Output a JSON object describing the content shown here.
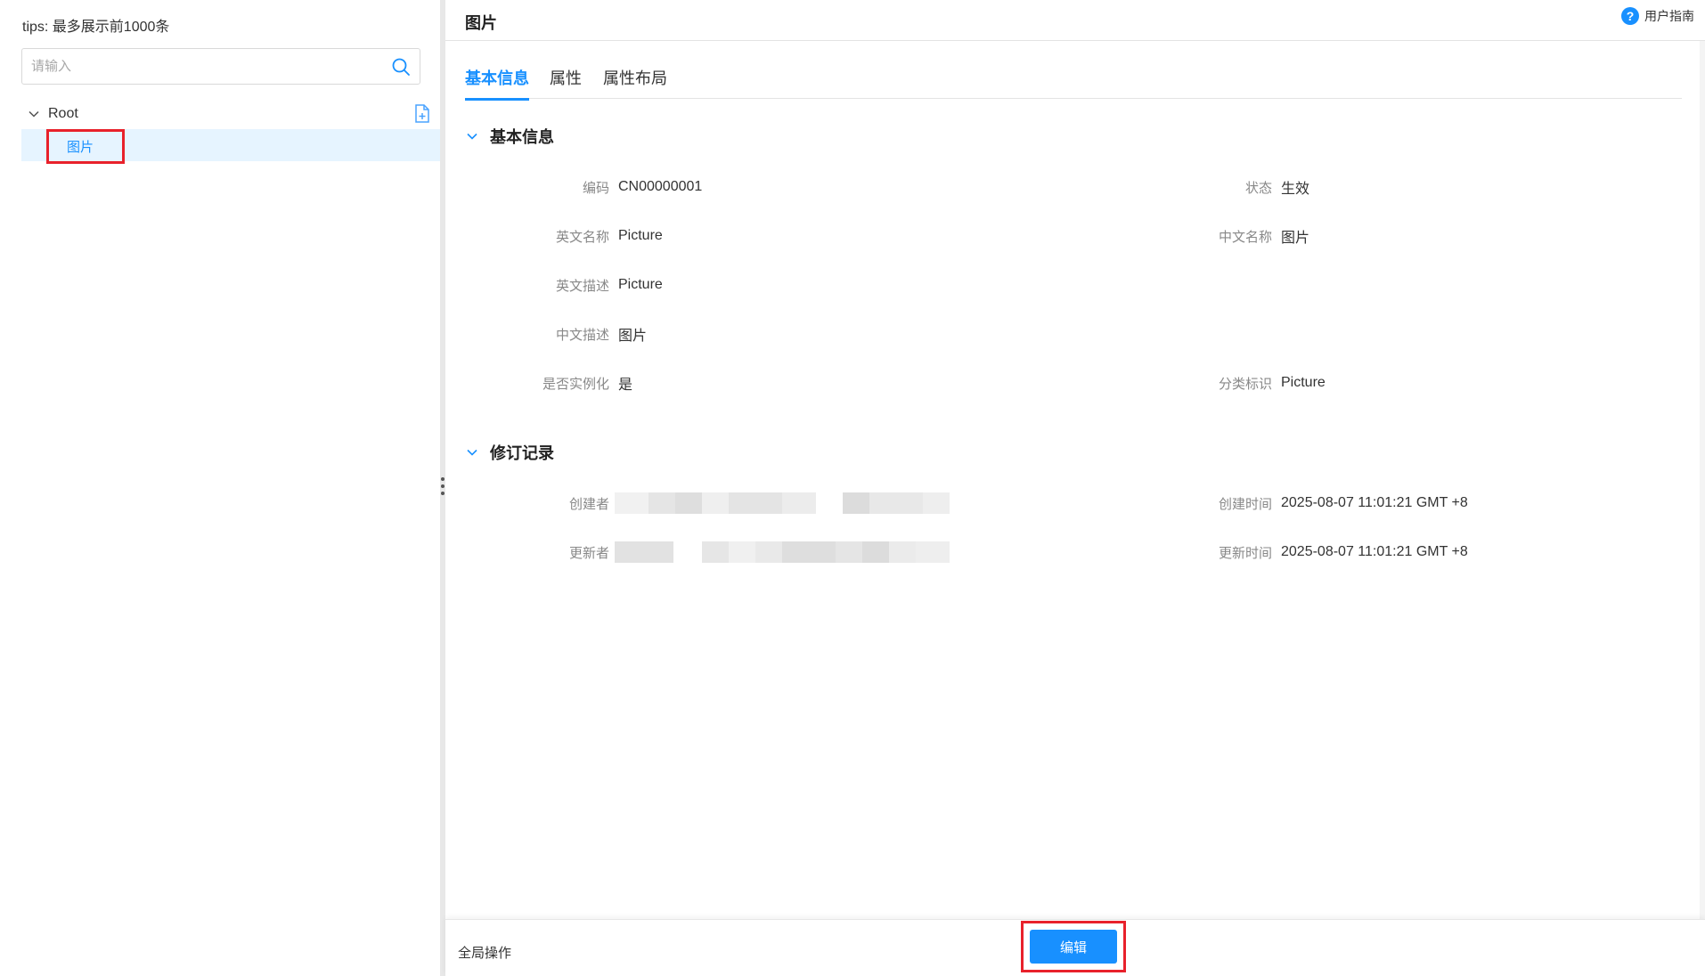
{
  "left": {
    "tips": "tips: 最多展示前1000条",
    "search_placeholder": "请输入",
    "tree": {
      "root_label": "Root",
      "child_label": "图片"
    }
  },
  "header": {
    "title": "图片",
    "guide_label": "用户指南",
    "guide_icon": "?"
  },
  "tabs": [
    "基本信息",
    "属性",
    "属性布局"
  ],
  "basic": {
    "title": "基本信息",
    "fields": {
      "code": {
        "label": "编码",
        "value": "CN00000001"
      },
      "status": {
        "label": "状态",
        "value": "生效"
      },
      "en_name": {
        "label": "英文名称",
        "value": "Picture"
      },
      "cn_name": {
        "label": "中文名称",
        "value": "图片"
      },
      "en_desc": {
        "label": "英文描述",
        "value": "Picture"
      },
      "cn_desc": {
        "label": "中文描述",
        "value": "图片"
      },
      "instantiable": {
        "label": "是否实例化",
        "value": "是"
      },
      "category_id": {
        "label": "分类标识",
        "value": "Picture"
      }
    }
  },
  "revision": {
    "title": "修订记录",
    "fields": {
      "creator": {
        "label": "创建者"
      },
      "created_at": {
        "label": "创建时间",
        "value": "2025-08-07 11:01:21 GMT +8"
      },
      "updater": {
        "label": "更新者"
      },
      "updated_at": {
        "label": "更新时间",
        "value": "2025-08-07 11:01:21 GMT +8"
      }
    }
  },
  "footer": {
    "global_ops": "全局操作",
    "edit_label": "编辑"
  },
  "colors": {
    "accent": "#1890ff",
    "highlight_box": "#e8212b",
    "selected_bg": "#e6f4ff"
  }
}
